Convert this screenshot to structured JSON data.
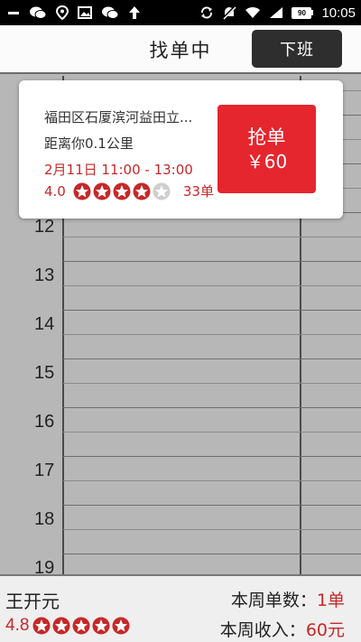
{
  "status_bar": {
    "time": "10:05",
    "battery": "90",
    "icons": [
      "minus-icon",
      "wechat-icon",
      "location-icon",
      "image-icon",
      "wechat-icon",
      "upload-arrow-icon",
      "sync-icon",
      "mute-icon",
      "wifi-icon",
      "signal-icon",
      "battery-icon"
    ]
  },
  "header": {
    "title": "找单中",
    "offduty_button": "下班"
  },
  "calendar": {
    "hours": [
      "12",
      "13",
      "14",
      "15",
      "16",
      "17",
      "18",
      "19"
    ]
  },
  "order": {
    "address": "福田区石厦滨河益田立...",
    "distance": "距离你0.1公里",
    "time": "2月11日 11:00 - 13:00",
    "rating": "4.0",
    "rating_stars": 4,
    "order_count": "33单",
    "grab_label": "抢单",
    "grab_price": "￥60",
    "colors": {
      "accent": "#e5262e",
      "text_red": "#c62828"
    }
  },
  "footer": {
    "name": "王开元",
    "rating": "4.8",
    "rating_stars": 5,
    "week_orders_label": "本周单数：",
    "week_orders_value": "1单",
    "week_income_label": "本周收入：",
    "week_income_value": "60元"
  }
}
